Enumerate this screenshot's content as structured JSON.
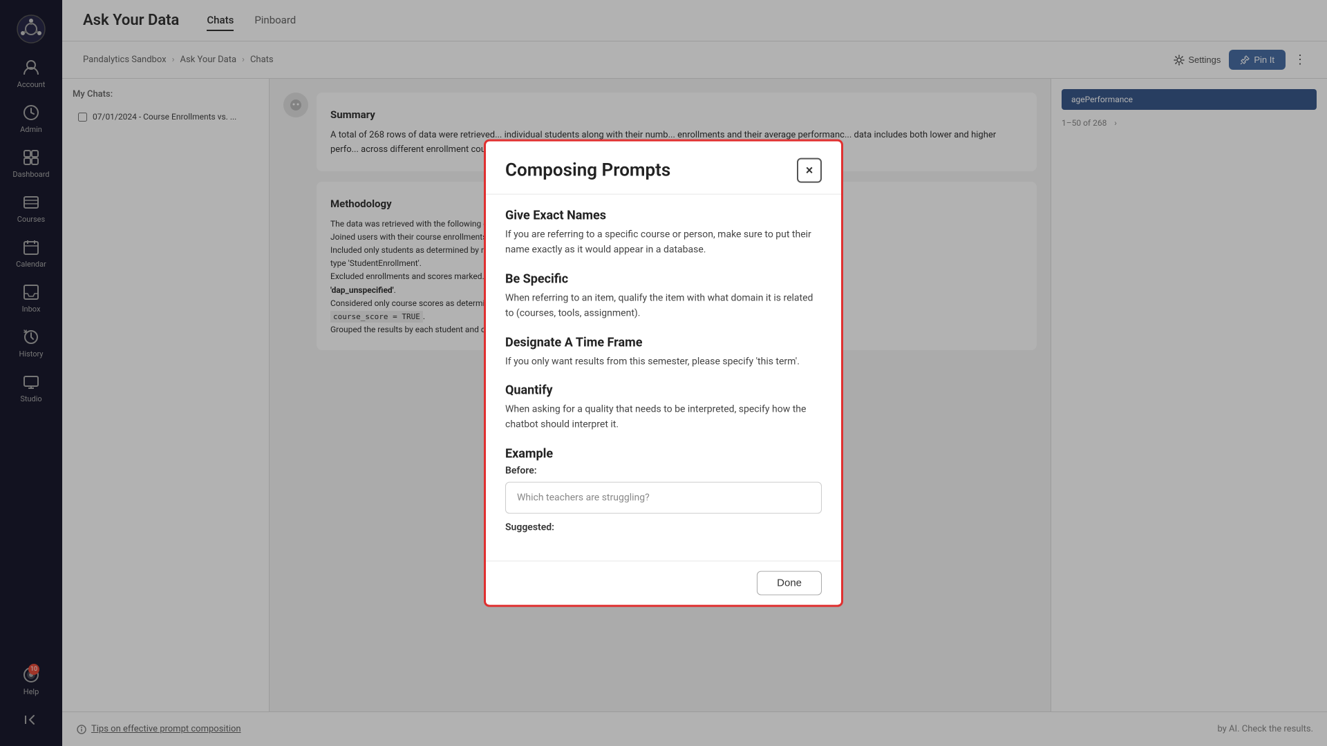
{
  "app": {
    "title": "Ask Your Data"
  },
  "sidebar": {
    "logo_label": "Pandalytics Logo",
    "items": [
      {
        "id": "account",
        "label": "Account",
        "icon": "👤"
      },
      {
        "id": "admin",
        "label": "Admin",
        "icon": "🛡"
      },
      {
        "id": "dashboard",
        "label": "Dashboard",
        "icon": "📊"
      },
      {
        "id": "courses",
        "label": "Courses",
        "icon": "📚"
      },
      {
        "id": "calendar",
        "label": "Calendar",
        "icon": "📅"
      },
      {
        "id": "inbox",
        "label": "Inbox",
        "icon": "📥"
      },
      {
        "id": "history",
        "label": "History",
        "icon": "🕐"
      },
      {
        "id": "studio",
        "label": "Studio",
        "icon": "🖥"
      },
      {
        "id": "help",
        "label": "Help",
        "icon": "🤖",
        "badge": "10"
      }
    ],
    "collapse_label": "Collapse"
  },
  "topbar": {
    "title": "Ask Your Data",
    "tabs": [
      {
        "id": "chats",
        "label": "Chats",
        "active": true
      },
      {
        "id": "pinboard",
        "label": "Pinboard",
        "active": false
      }
    ]
  },
  "breadcrumb": {
    "items": [
      "Pandalytics Sandbox",
      "Ask Your Data",
      "Chats"
    ]
  },
  "breadcrumb_actions": {
    "settings_label": "Settings",
    "pin_label": "Pin It"
  },
  "my_chats": {
    "label": "My Chats:",
    "items": [
      {
        "date": "07/01/2024 - Course Enrollments vs. ..."
      }
    ]
  },
  "chat_content": {
    "summary_title": "Summary",
    "summary_text": "A total of 268 rows of data were retrieved... individual students along with their numb... enrollments and their average performanc... data includes both lower and higher perfo... across different enrollment counts, indica... in students' average performance.",
    "methodology_title": "Methodology",
    "methodology_text": "The data was retrieved with the following c... Joined users with their course enrollments... Included only students as determined by r... type 'StudentEnrollment'. Excluded enrollments and scores marked... 'dap_unspecified'. Considered only course scores as determin... course_score = TRUE. Grouped the results by each student and c..."
  },
  "right_panel": {
    "tab_label": "agePerformance"
  },
  "pagination": {
    "text": "1–50 of 268"
  },
  "bottom": {
    "hint": "by AI. Check the results.",
    "tip": "Tips on effective prompt composition"
  },
  "modal": {
    "title": "Composing Prompts",
    "close_label": "×",
    "sections": [
      {
        "id": "exact-names",
        "heading": "Give Exact Names",
        "body": "If you are referring to a specific course or person, make sure to put their name exactly as it would appear in a database."
      },
      {
        "id": "be-specific",
        "heading": "Be Specific",
        "body": "When referring to an item, qualify the item with what domain it is related to (courses, tools, assignment)."
      },
      {
        "id": "time-frame",
        "heading": "Designate A Time Frame",
        "body": "If you only want results from this semester, please specify 'this term'."
      },
      {
        "id": "quantify",
        "heading": "Quantify",
        "body": "When asking for a quality that needs to be interpreted, specify how the chatbot should interpret it."
      },
      {
        "id": "example",
        "heading": "Example",
        "before_label": "Before:",
        "before_placeholder": "Which teachers are struggling?",
        "suggested_label": "Suggested:"
      }
    ],
    "done_label": "Done"
  }
}
